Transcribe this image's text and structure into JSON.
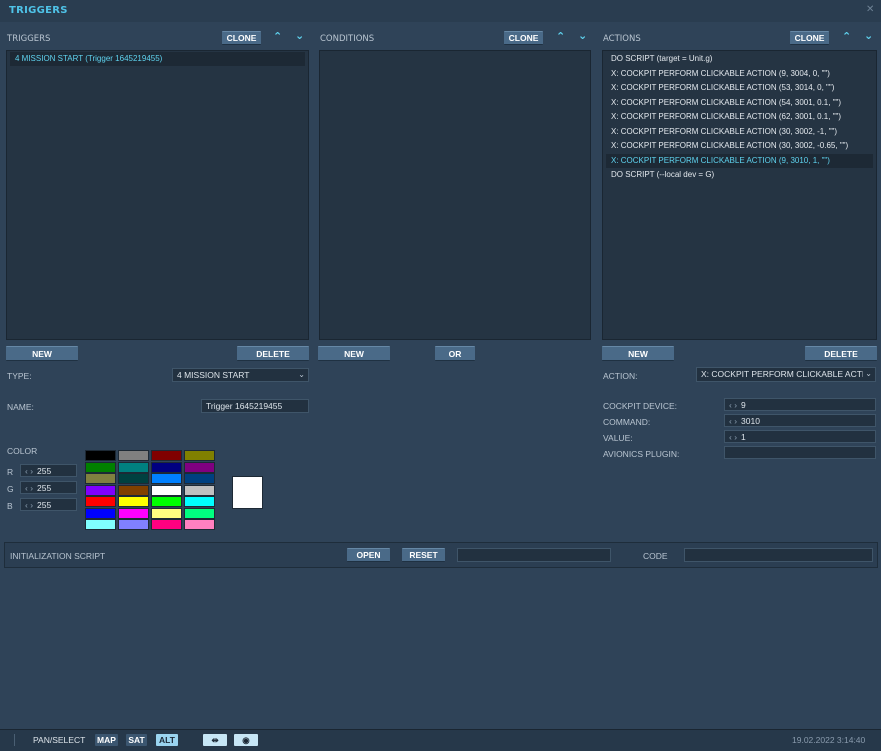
{
  "window": {
    "title": "TRIGGERS"
  },
  "triggers": {
    "label": "TRIGGERS",
    "clone_label": "CLONE",
    "items": [
      "4 MISSION START (Trigger 1645219455)"
    ],
    "new_label": "NEW",
    "delete_label": "DELETE",
    "type_label": "TYPE:",
    "type_value": "4 MISSION START",
    "name_label": "NAME:",
    "name_value": "Trigger 1645219455",
    "color_label": "COLOR",
    "r_label": "R",
    "r_value": "255",
    "g_label": "G",
    "g_value": "255",
    "b_label": "B",
    "b_value": "255",
    "current_color": "#ffffff",
    "palette": [
      "#000000",
      "#808080",
      "#800000",
      "#808000",
      "#008000",
      "#008080",
      "#000080",
      "#800080",
      "#808040",
      "#004040",
      "#0080ff",
      "#004080",
      "#8000ff",
      "#804000",
      "#ffffff",
      "#c0c0c0",
      "#ff0000",
      "#ffff00",
      "#00ff00",
      "#00ffff",
      "#0000ff",
      "#ff00ff",
      "#ffff80",
      "#00ff80",
      "#80ffff",
      "#8080ff",
      "#ff0080",
      "#ff80c0"
    ]
  },
  "conditions": {
    "label": "CONDITIONS",
    "clone_label": "CLONE",
    "new_label": "NEW",
    "or_label": "OR"
  },
  "actions": {
    "label": "ACTIONS",
    "clone_label": "CLONE",
    "items": [
      "DO SCRIPT (target = Unit.g)",
      "X: COCKPIT PERFORM CLICKABLE ACTION (9, 3004, 0, \"\")",
      "X: COCKPIT PERFORM CLICKABLE ACTION (53, 3014, 0, \"\")",
      "X: COCKPIT PERFORM CLICKABLE ACTION (54, 3001, 0.1, \"\")",
      "X: COCKPIT PERFORM CLICKABLE ACTION (62, 3001, 0.1, \"\")",
      "X: COCKPIT PERFORM CLICKABLE ACTION (30, 3002, -1, \"\")",
      "X: COCKPIT PERFORM CLICKABLE ACTION (30, 3002, -0.65, \"\")",
      "X: COCKPIT PERFORM CLICKABLE ACTION (9, 3010, 1, \"\")",
      "DO SCRIPT (--local dev = G)"
    ],
    "new_label": "NEW",
    "delete_label": "DELETE",
    "action_label": "ACTION:",
    "action_value": "X: COCKPIT PERFORM CLICKABLE ACTIO",
    "cockpit_device_label": "COCKPIT DEVICE:",
    "cockpit_device_value": "9",
    "command_label": "COMMAND:",
    "command_value": "3010",
    "value_label": "VALUE:",
    "value_value": "1",
    "avionics_label": "AVIONICS PLUGIN:",
    "avionics_value": ""
  },
  "init_script": {
    "label": "INITIALIZATION SCRIPT",
    "open_label": "OPEN",
    "reset_label": "RESET",
    "path_value": "",
    "code_label": "CODE",
    "code_value": ""
  },
  "statusbar": {
    "mode": "PAN/SELECT",
    "map": "MAP",
    "sat": "SAT",
    "alt": "ALT",
    "datetime": "19.02.2022 3:14:40"
  }
}
